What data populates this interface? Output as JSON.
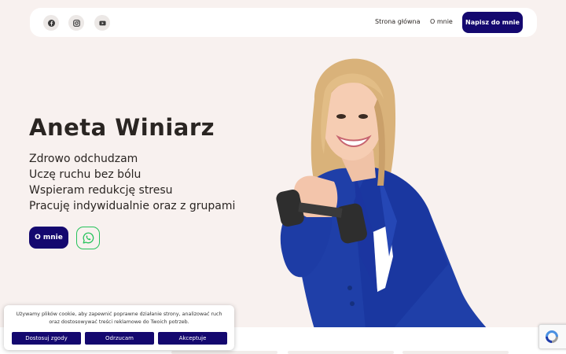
{
  "nav": {
    "social": [
      {
        "icon": "facebook-icon"
      },
      {
        "icon": "instagram-icon"
      },
      {
        "icon": "youtube-icon"
      }
    ],
    "links": [
      "Strona główna",
      "O mnie"
    ],
    "cta": "Napisz do mnie"
  },
  "hero": {
    "name": "Aneta Winiarz",
    "taglines": [
      "Zdrowo odchudzam",
      "Uczę ruchu bez bólu",
      "Wspieram redukcję stresu",
      "Pracuję indywidualnie oraz z grupami"
    ],
    "about_button": "O mnie",
    "whatsapp_icon": "whatsapp-icon",
    "photo": "woman-with-dumbbell-photo"
  },
  "cookie": {
    "text": "Używamy plików cookie, aby zapewnić poprawne działanie strony, analizować ruch oraz dostosowywać treści reklamowe do Twoich potrzeb.",
    "buttons": [
      "Dostosuj zgody",
      "Odrzucam",
      "Akceptuje"
    ]
  },
  "recaptcha_icon": "recaptcha-icon",
  "colors": {
    "background": "#f8f1ef",
    "primary": "#14086f",
    "whatsapp": "#25c25a",
    "jacket": "#1f3fa8"
  }
}
